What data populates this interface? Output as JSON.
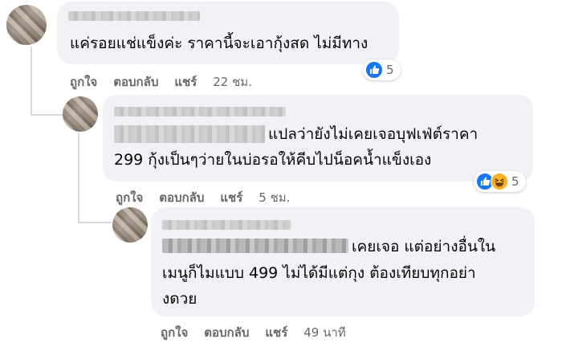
{
  "comments": [
    {
      "id": "c1",
      "text_lines": [
        "แค่รอยแช่แข็งค่ะ ราคานี้จะเอากุ้งสด ไม่มีทาง"
      ],
      "actions": {
        "like": "ถูกใจ",
        "reply": "ตอบกลับ",
        "share": "แชร์",
        "time": "22 ชม."
      },
      "reactions": {
        "icons": [
          "like-icon"
        ],
        "count": "5"
      }
    },
    {
      "id": "c2",
      "text_lines": [
        "แปลว่ายังไม่เคยเจอบุฟเฟ่ต์ราคา",
        "299 กุ้งเป็นๆว่ายในบ่อรอให้คีบไปน็อคน้ำแข็งเอง"
      ],
      "actions": {
        "like": "ถูกใจ",
        "reply": "ตอบกลับ",
        "share": "แชร์",
        "time": "5 ชม."
      },
      "reactions": {
        "icons": [
          "like-icon",
          "haha-icon"
        ],
        "count": "5"
      }
    },
    {
      "id": "c3",
      "text_lines": [
        "เคยเจอ แต่อย่างอื่นใน",
        "เมนูก็ไมแบบ 499 ไม่ได้มีแต่กุง ต้องเทียบทุกอย่า",
        "งดวย"
      ],
      "actions": {
        "like": "ถูกใจ",
        "reply": "ตอบกลับ",
        "share": "แชร์",
        "time": "49 นาที"
      }
    }
  ],
  "colors": {
    "bubble": "#f0f2f5",
    "meta": "#65676b",
    "like_blue": "#1877f2",
    "haha_yellow": "#f7b125"
  }
}
